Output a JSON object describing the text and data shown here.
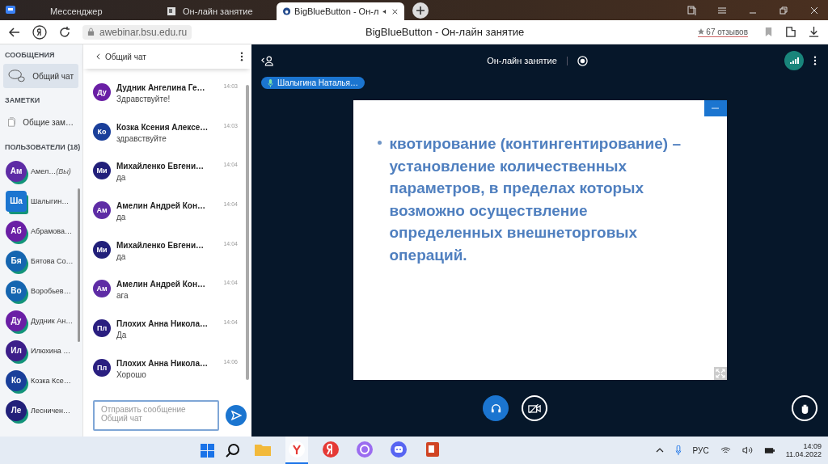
{
  "browser": {
    "tabs": [
      {
        "title": "Мессенджер",
        "selected": false
      },
      {
        "title": "Он-лайн занятие",
        "selected": false
      },
      {
        "title": "BigBlueButton - Он-л",
        "selected": true
      }
    ],
    "url": "awebinar.bsu.edu.ru",
    "page_title": "BigBlueButton - Он-лайн занятие",
    "reviews": "67 отзывов"
  },
  "sidebar": {
    "messages_heading": "СООБЩЕНИЯ",
    "chat_item": {
      "label": "Общий чат",
      "selected": true
    },
    "notes_heading": "ЗАМЕТКИ",
    "notes_item": "Общие зам…",
    "users_heading": "ПОЛЬЗОВАТЕЛИ (18)",
    "users": [
      {
        "initials": "Ам",
        "name": "Амел…",
        "you_label": "(Вы)",
        "color": "#5e2ca5",
        "presenter": false
      },
      {
        "initials": "Ша",
        "name": "Шалыгин…",
        "color": "#1b75d0",
        "presenter": true
      },
      {
        "initials": "Аб",
        "name": "Абрамова…",
        "color": "#6a1fa5",
        "presenter": false
      },
      {
        "initials": "Бя",
        "name": "Бятова Со…",
        "color": "#1565b0",
        "presenter": false
      },
      {
        "initials": "Во",
        "name": "Воробьев…",
        "color": "#1565b0",
        "presenter": false
      },
      {
        "initials": "Ду",
        "name": "Дудник Ан…",
        "color": "#6a1fa5",
        "presenter": false
      },
      {
        "initials": "Ил",
        "name": "Илюхина …",
        "color": "#3d1f8a",
        "presenter": false
      },
      {
        "initials": "Ко",
        "name": "Козка Ксе…",
        "color": "#1a3f9a",
        "presenter": false
      },
      {
        "initials": "Ле",
        "name": "Лесничен…",
        "color": "#22207a",
        "presenter": false
      }
    ]
  },
  "chat": {
    "title": "Общий чат",
    "messages": [
      {
        "initials": "Ду",
        "color": "#6a1fa5",
        "name": "Дудник Ангелина Ге…",
        "time": "14:03",
        "text": "Здравствуйте!"
      },
      {
        "initials": "Ко",
        "color": "#1a3f9a",
        "name": "Козка Ксения Алексе…",
        "time": "14:03",
        "text": "здравствуйте"
      },
      {
        "initials": "Ми",
        "color": "#22207a",
        "name": "Михайленко Евгени…",
        "time": "14:04",
        "text": "да"
      },
      {
        "initials": "Ам",
        "color": "#5e2ca5",
        "name": "Амелин Андрей Кон…",
        "time": "14:04",
        "text": "да"
      },
      {
        "initials": "Ми",
        "color": "#22207a",
        "name": "Михайленко Евгени…",
        "time": "14:04",
        "text": "да"
      },
      {
        "initials": "Ам",
        "color": "#5e2ca5",
        "name": "Амелин Андрей Кон…",
        "time": "14:04",
        "text": "ага"
      },
      {
        "initials": "Пл",
        "color": "#2a1f80",
        "name": "Плохих Анна Никола…",
        "time": "14:04",
        "text": "Да"
      },
      {
        "initials": "Пл",
        "color": "#2a1f80",
        "name": "Плохих Анна Никола…",
        "time": "14:06",
        "text": "Хорошо"
      }
    ],
    "input_placeholder": "Отправить сообщение Общий чат"
  },
  "meeting": {
    "title": "Он-лайн занятие",
    "presenter": "Шалыгина Наталья…",
    "slide_bullet": "квотирование (контингентирование) – установление количественных параметров, в пределах которых возможно осуществление определенных внешнеторговых операций."
  },
  "taskbar": {
    "apps": [
      {
        "kind": "folder",
        "active": false
      },
      {
        "kind": "browser",
        "active": true
      },
      {
        "kind": "yandex",
        "active": false
      },
      {
        "kind": "alice",
        "active": false
      },
      {
        "kind": "discord",
        "active": false
      },
      {
        "kind": "powerpoint",
        "active": false
      }
    ],
    "language": "РУС",
    "time": "14:09",
    "date": "11.04.2022"
  }
}
